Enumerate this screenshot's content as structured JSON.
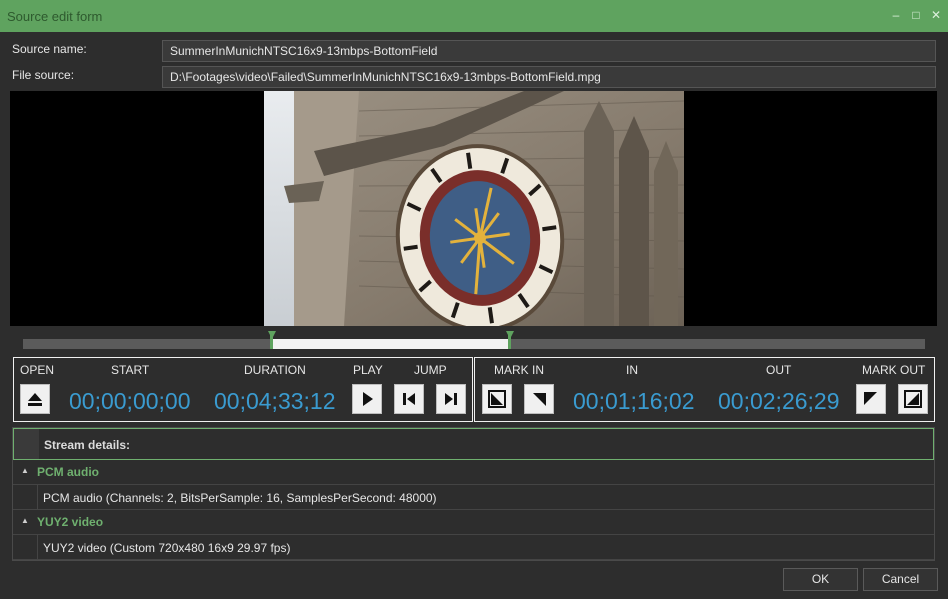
{
  "window": {
    "title": "Source edit form",
    "controls": [
      "minimize-icon",
      "maximize-icon",
      "close-icon"
    ],
    "minimize_glyph": "–",
    "maximize_glyph": "□",
    "close_glyph": "✕"
  },
  "fields": {
    "source_name": {
      "label": "Source name:",
      "value": "SummerInMunichNTSC16x9-13mbps-BottomField"
    },
    "file_source": {
      "label": "File source:",
      "value": "D:\\Footages\\video\\Failed\\SummerInMunichNTSC16x9-13mbps-BottomField.mpg"
    }
  },
  "timeline": {
    "selection_start_fraction": 0.276,
    "selection_end_fraction": 0.54
  },
  "transport": {
    "open_label": "OPEN",
    "start_label": "START",
    "duration_label": "DURATION",
    "play_label": "PLAY",
    "jump_label": "JUMP",
    "start_tc": "00;00;00;00",
    "duration_tc": "00;04;33;12"
  },
  "marks": {
    "mark_in_label": "MARK IN",
    "in_label": "IN",
    "out_label": "OUT",
    "mark_out_label": "MARK OUT",
    "in_tc": "00;01;16;02",
    "out_tc": "00;02;26;29"
  },
  "streams": {
    "header": "Stream details:",
    "groups": [
      {
        "name": "PCM audio",
        "item": "PCM audio (Channels: 2, BitsPerSample: 16, SamplesPerSecond: 48000)"
      },
      {
        "name": "YUY2 video",
        "item": "YUY2 video (Custom 720x480 16x9 29.97 fps)"
      }
    ]
  },
  "buttons": {
    "ok": "OK",
    "cancel": "Cancel"
  },
  "colors": {
    "accent": "#5fa35f",
    "timecode": "#3a9bd0",
    "background": "#2d2d2d"
  }
}
